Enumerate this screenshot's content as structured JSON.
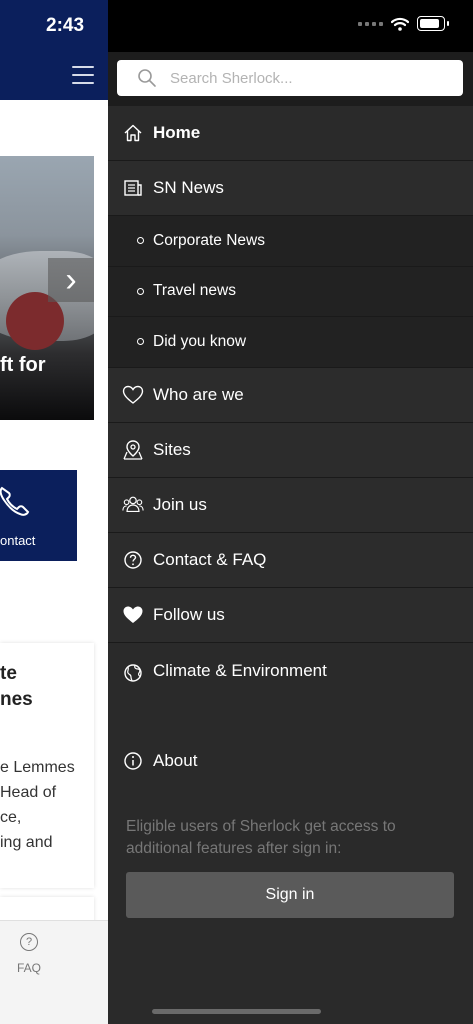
{
  "status": {
    "time": "2:43"
  },
  "background_page": {
    "hero_title": "ft for",
    "contact_label": "ontact",
    "card_title_line1": "te",
    "card_title_line2": "nes",
    "card_body_line1": "e Lemmes",
    "card_body_line2": "Head of",
    "card_body_line3": "ce,",
    "card_body_line4": "ing and",
    "tab_faq_label": "FAQ"
  },
  "drawer": {
    "search_placeholder": "Search Sherlock...",
    "items": [
      {
        "label": "Home",
        "icon": "home-icon",
        "type": "main"
      },
      {
        "label": "SN News",
        "icon": "newspaper-icon",
        "type": "main"
      },
      {
        "label": "Corporate News",
        "type": "sub"
      },
      {
        "label": "Travel news",
        "type": "sub"
      },
      {
        "label": "Did you know",
        "type": "sub"
      },
      {
        "label": "Who are we",
        "icon": "heart-outline-icon",
        "type": "main"
      },
      {
        "label": "Sites",
        "icon": "map-pin-icon",
        "type": "main"
      },
      {
        "label": "Join us",
        "icon": "people-icon",
        "type": "main"
      },
      {
        "label": "Contact & FAQ",
        "icon": "question-circle-icon",
        "type": "main"
      },
      {
        "label": "Follow us",
        "icon": "heart-filled-icon",
        "type": "main"
      },
      {
        "label": "Climate & Environment",
        "icon": "globe-icon",
        "type": "main"
      },
      {
        "label": "About",
        "icon": "info-icon",
        "type": "main"
      }
    ],
    "signin_text": "Eligible users of Sherlock get access to additional features after sign in:",
    "signin_button": "Sign in"
  }
}
